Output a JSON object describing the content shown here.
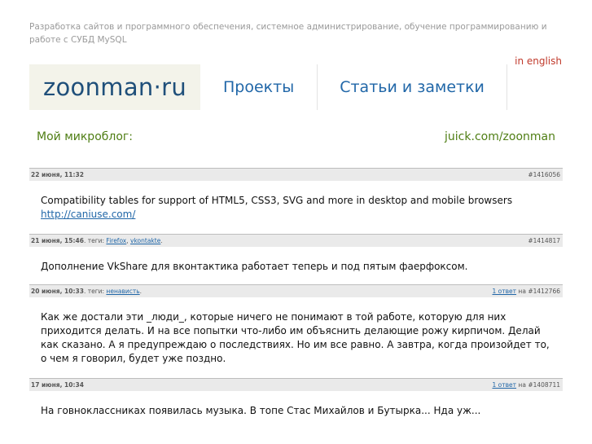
{
  "site": {
    "tagline": "Разработка сайтов и программного обеспечения, системное администрирование, обучение программированию и работе с СУБД MySQL",
    "lang_link": "in english",
    "logo_main": "zoonman",
    "logo_dot": "·",
    "logo_tld": "ru"
  },
  "nav": {
    "items": [
      {
        "label": "Проекты"
      },
      {
        "label": "Статьи и заметки"
      }
    ]
  },
  "microblog": {
    "label": "Мой микроблог:",
    "link": "juick.com/zoonman"
  },
  "posts": [
    {
      "date": "22 июня, 11:32",
      "tags_prefix": "",
      "tags": [],
      "replies": "",
      "id_prefix": "",
      "id": "#1416056",
      "text": "Compatibility tables for support of HTML5, CSS3, SVG and more in desktop and mobile browsers",
      "link": "http://caniuse.com/"
    },
    {
      "date": "21 июня, 15:46",
      "tags_prefix": ". теги:",
      "tags": [
        "Firefox",
        "vkontakte"
      ],
      "replies": "",
      "id_prefix": "",
      "id": "#1414817",
      "text": "Дополнение VkShare для вконтактика работает теперь и под пятым фаерфоксом.",
      "link": ""
    },
    {
      "date": "20 июня, 10:33",
      "tags_prefix": ". теги:",
      "tags": [
        "ненависть"
      ],
      "replies": "1 ответ",
      "id_prefix": "на",
      "id": "#1412766",
      "text": "Как же достали эти _люди_, которые ничего не понимают в той работе, которую для них приходится делать. И на все попытки что-либо им объяснить делающие рожу кирпичом. Делай как сказано. А я предупреждаю о последствиях. Но им все равно. А завтра, когда произойдет то, о чем я говорил, будет уже поздно.",
      "link": ""
    },
    {
      "date": "17 июня, 10:34",
      "tags_prefix": "",
      "tags": [],
      "replies": "1 ответ",
      "id_prefix": "на",
      "id": "#1408711",
      "text": "На говноклассниках появилась музыка. В топе Стас Михайлов и Бутырка... Нда уж...",
      "link": ""
    }
  ]
}
